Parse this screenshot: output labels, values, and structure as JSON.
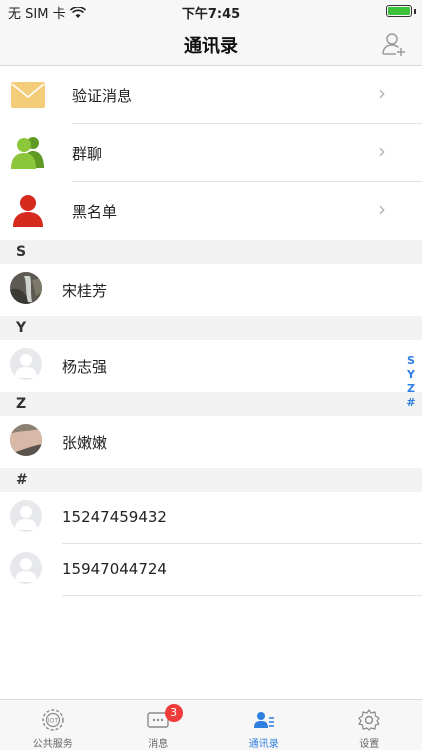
{
  "status_bar": {
    "carrier": "无 SIM 卡",
    "time": "下午7:45"
  },
  "nav": {
    "title": "通讯录"
  },
  "features": [
    {
      "label": "验证消息",
      "icon": "envelope-icon"
    },
    {
      "label": "群聊",
      "icon": "group-chat-icon"
    },
    {
      "label": "黑名单",
      "icon": "blacklist-icon"
    }
  ],
  "sections": [
    {
      "letter": "S",
      "contacts": [
        {
          "name": "宋桂芳",
          "avatar": "photo-waterfall"
        }
      ]
    },
    {
      "letter": "Y",
      "contacts": [
        {
          "name": "杨志强",
          "avatar": "default-avatar"
        }
      ]
    },
    {
      "letter": "Z",
      "contacts": [
        {
          "name": "张嫩嫩",
          "avatar": "photo-arm"
        }
      ]
    },
    {
      "letter": "#",
      "contacts": [
        {
          "name": "15247459432",
          "avatar": "default-avatar"
        },
        {
          "name": "15947044724",
          "avatar": "default-avatar"
        }
      ]
    }
  ],
  "index_bar": [
    "S",
    "Y",
    "Z",
    "#"
  ],
  "tabs": [
    {
      "label": "公共服务",
      "icon": "iot-icon",
      "active": false
    },
    {
      "label": "消息",
      "icon": "message-icon",
      "badge": "3",
      "active": false
    },
    {
      "label": "通讯录",
      "icon": "contacts-icon",
      "active": true
    },
    {
      "label": "设置",
      "icon": "settings-icon",
      "active": false
    }
  ],
  "colors": {
    "accent": "#2f7fe0",
    "badge": "#f03b3b",
    "battery": "#3cc13c",
    "group_icon": "#7ab82e",
    "blacklist_icon": "#d62a1e",
    "envelope": "#f3cd7a"
  }
}
